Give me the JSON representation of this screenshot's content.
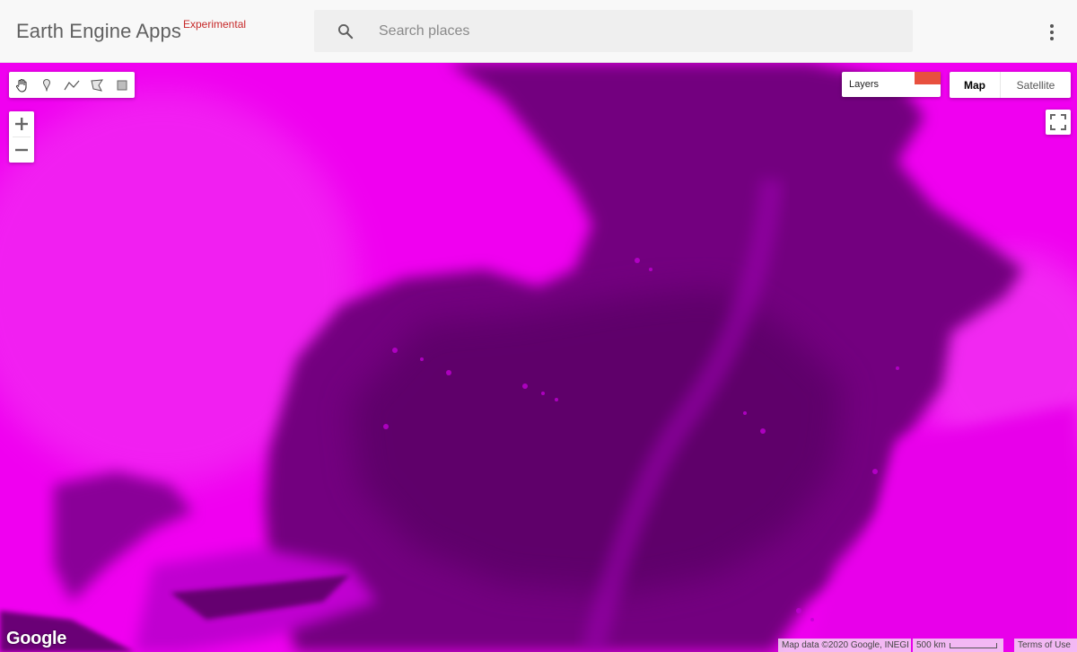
{
  "header": {
    "app_title": "Earth Engine Apps",
    "badge": "Experimental",
    "search_placeholder": "Search places",
    "search_value": ""
  },
  "map": {
    "layers_label": "Layers",
    "map_type_options": [
      "Map",
      "Satellite"
    ],
    "selected_map_type": "Map",
    "zoom_in": "+",
    "zoom_out": "−",
    "attribution": "Map data ©2020 Google, INEGI",
    "scale_label": "500 km",
    "terms": "Terms of Use",
    "logo_text": "Google"
  },
  "draw_tools": [
    {
      "name": "pan-hand-icon"
    },
    {
      "name": "marker-icon"
    },
    {
      "name": "polyline-icon"
    },
    {
      "name": "polygon-icon"
    },
    {
      "name": "rectangle-icon"
    }
  ],
  "colors": {
    "land_bright": "#f000f0",
    "land_mid": "#b400c0",
    "water_dark": "#6a0078",
    "water_deep": "#560062",
    "layer_swatch": "#e8503e",
    "badge_red": "#c62828"
  }
}
